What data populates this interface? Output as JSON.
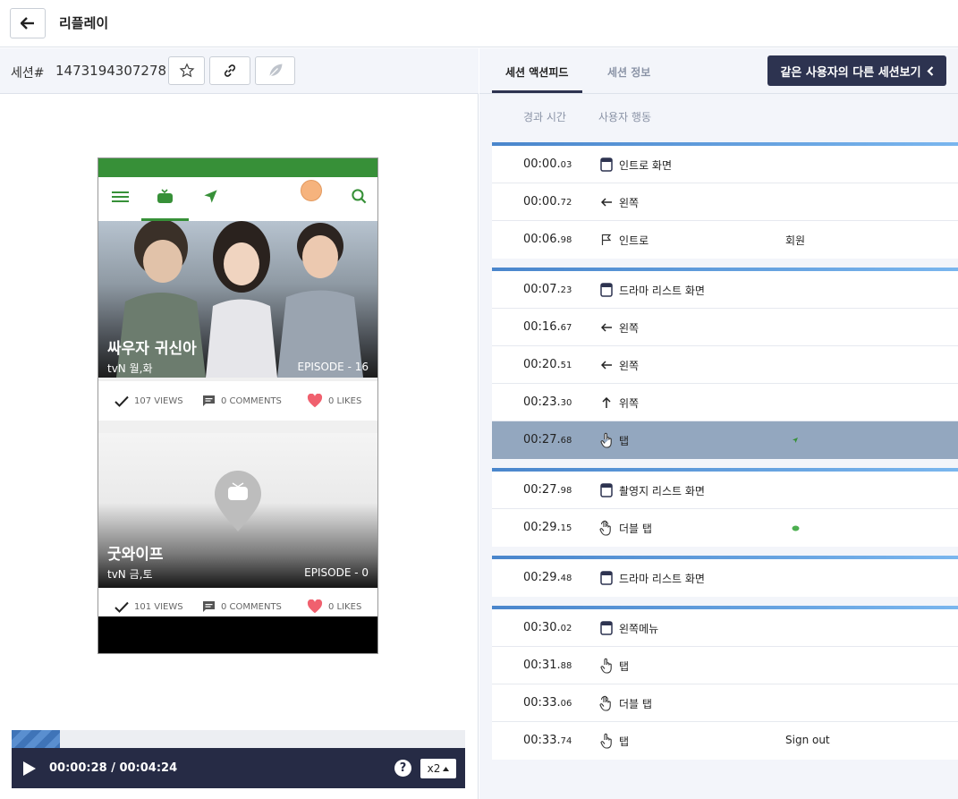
{
  "header": {
    "title": "리플레이"
  },
  "session": {
    "label": "세션#",
    "id": "1473194307278"
  },
  "phone": {
    "cards": [
      {
        "title": "싸우자 귀신아",
        "channel": "tvN 월,화",
        "episode": "EPISODE - 16",
        "views": "107 VIEWS",
        "comments": "0 COMMENTS",
        "likes": "0 LIKES"
      },
      {
        "title": "굿와이프",
        "channel": "tvN 금,토",
        "episode": "EPISODE - 0",
        "views": "101 VIEWS",
        "comments": "0 COMMENTS",
        "likes": "0 LIKES"
      }
    ]
  },
  "player": {
    "time": "00:00:28 / 00:04:24",
    "speed": "x2",
    "help": "?",
    "progress": 0.106
  },
  "tabs": [
    {
      "label": "세션 액션피드"
    },
    {
      "label": "세션 정보"
    }
  ],
  "other_sessions_button": "같은 사용자의 다른 세션보기",
  "columns": {
    "time": "경과 시간",
    "action": "사용자 행동"
  },
  "feed": [
    {
      "rows": [
        {
          "time": "00:00.",
          "ms": "03",
          "icon": "screen-icon",
          "action": "인트로 화면",
          "extra": ""
        },
        {
          "time": "00:00.",
          "ms": "72",
          "icon": "arrow-left-icon",
          "action": "왼쪽",
          "extra": ""
        },
        {
          "time": "00:06.",
          "ms": "98",
          "icon": "flag-icon",
          "action": "인트로",
          "extra": "회원"
        }
      ]
    },
    {
      "rows": [
        {
          "time": "00:07.",
          "ms": "23",
          "icon": "screen-icon",
          "action": "드라마 리스트 화면",
          "extra": ""
        },
        {
          "time": "00:16.",
          "ms": "67",
          "icon": "arrow-left-icon",
          "action": "왼쪽",
          "extra": ""
        },
        {
          "time": "00:20.",
          "ms": "51",
          "icon": "arrow-left-icon",
          "action": "왼쪽",
          "extra": ""
        },
        {
          "time": "00:23.",
          "ms": "30",
          "icon": "arrow-up-icon",
          "action": "위쪽",
          "extra": ""
        },
        {
          "time": "00:27.",
          "ms": "68",
          "icon": "tap-icon",
          "action": "탭",
          "extra": "",
          "highlight": true,
          "thumb": "navigation-thumb-icon"
        }
      ]
    },
    {
      "rows": [
        {
          "time": "00:27.",
          "ms": "98",
          "icon": "screen-icon",
          "action": "촬영지 리스트 화면",
          "extra": ""
        },
        {
          "time": "00:29.",
          "ms": "15",
          "icon": "double-tap-icon",
          "action": "더블 탭",
          "extra": "",
          "thumb": "green-dot-thumb-icon"
        }
      ]
    },
    {
      "rows": [
        {
          "time": "00:29.",
          "ms": "48",
          "icon": "screen-icon",
          "action": "드라마 리스트 화면",
          "extra": ""
        }
      ]
    },
    {
      "rows": [
        {
          "time": "00:30.",
          "ms": "02",
          "icon": "screen-icon",
          "action": "왼쪽메뉴",
          "extra": ""
        },
        {
          "time": "00:31.",
          "ms": "88",
          "icon": "tap-icon",
          "action": "탭",
          "extra": ""
        },
        {
          "time": "00:33.",
          "ms": "06",
          "icon": "double-tap-icon",
          "action": "더블 탭",
          "extra": ""
        },
        {
          "time": "00:33.",
          "ms": "74",
          "icon": "tap-icon",
          "action": "탭",
          "extra": "Sign out"
        }
      ]
    }
  ],
  "colors": {
    "dark_navy": "#2d3350",
    "brand_green": "#379038",
    "accent_blue": "#4a86cc",
    "highlight_row": "#93a7bf"
  }
}
